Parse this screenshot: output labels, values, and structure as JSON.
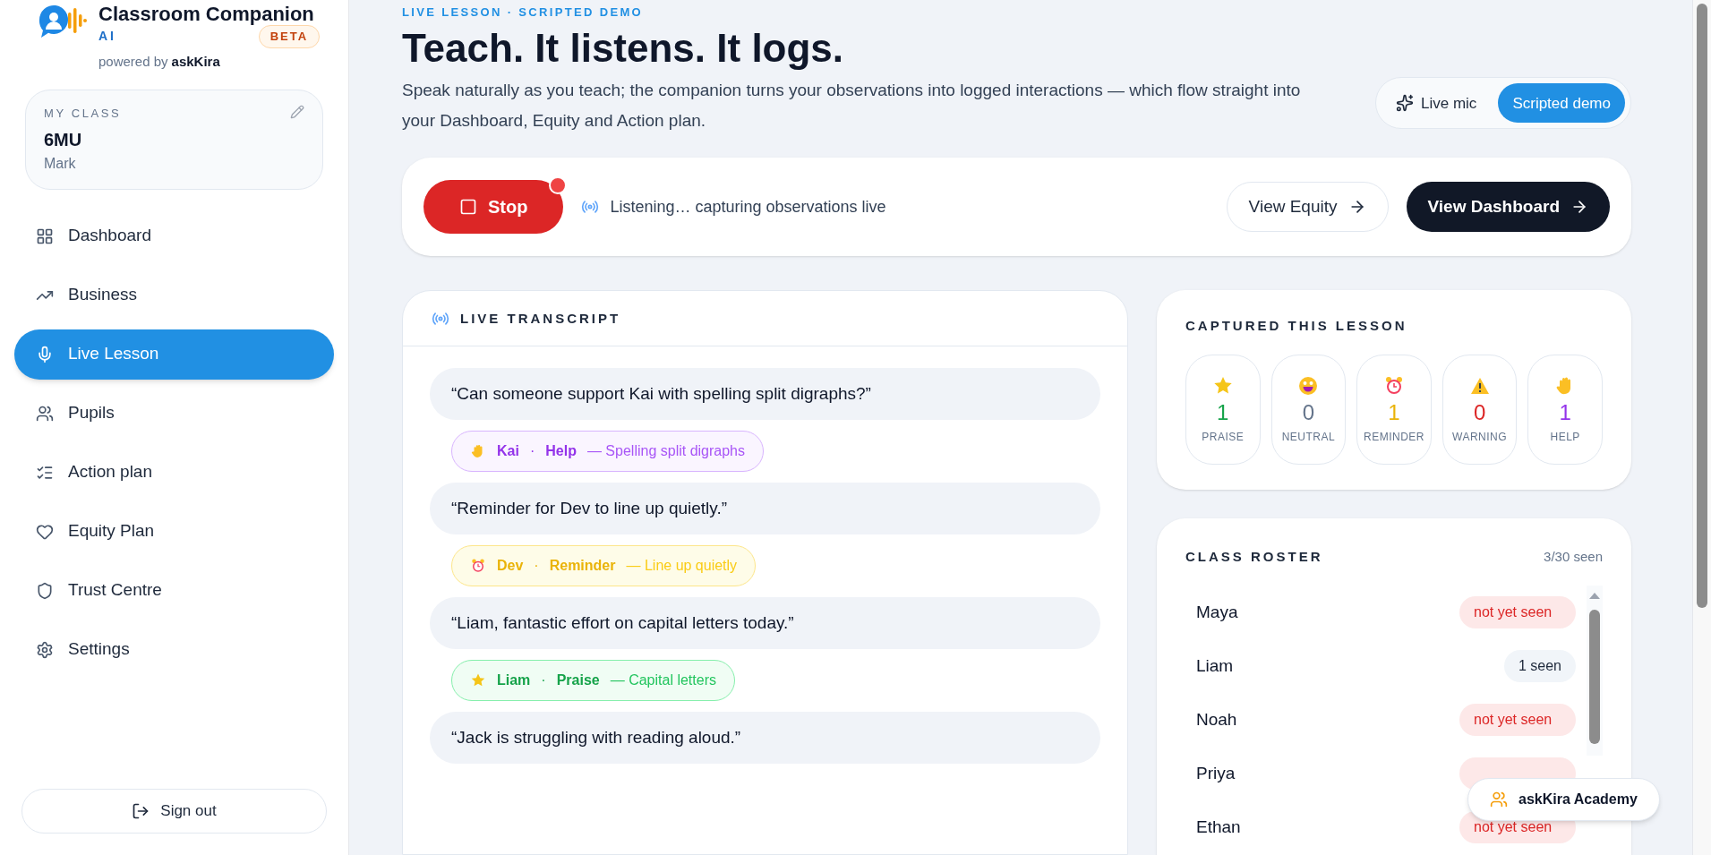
{
  "brand": {
    "title": "Classroom Companion",
    "subtitle": "AI",
    "badge": "BETA",
    "powered_prefix": "powered by",
    "powered_name": "askKira"
  },
  "class_card": {
    "label": "MY CLASS",
    "name": "6MU",
    "teacher": "Mark"
  },
  "nav": [
    {
      "label": "Dashboard",
      "selected": false
    },
    {
      "label": "Business",
      "selected": false
    },
    {
      "label": "Live Lesson",
      "selected": true
    },
    {
      "label": "Pupils",
      "selected": false
    },
    {
      "label": "Action plan",
      "selected": false
    },
    {
      "label": "Equity Plan",
      "selected": false
    },
    {
      "label": "Trust Centre",
      "selected": false
    },
    {
      "label": "Settings",
      "selected": false
    }
  ],
  "sign_out": "Sign out",
  "header": {
    "eyebrow": "LIVE LESSON · SCRIPTED DEMO",
    "title": "Teach. It listens. It logs.",
    "description": "Speak naturally as you teach; the companion turns your observations into logged interactions — which flow straight into your Dashboard, Equity and Action plan."
  },
  "mode_toggle": [
    {
      "label": "Live mic",
      "selected": false
    },
    {
      "label": "Scripted demo",
      "selected": true
    }
  ],
  "control_bar": {
    "stop_button": "Stop",
    "recording": true,
    "status": "Listening… capturing observations live",
    "view_equity": "View Equity",
    "view_dashboard": "View Dashboard"
  },
  "transcript": {
    "title": "LIVE TRANSCRIPT",
    "items": [
      {
        "quote": "“Can someone support Kai with spelling split digraphs?”",
        "tag": {
          "kind": "help",
          "pupil": "Kai",
          "separator": "·",
          "category": "Help",
          "note": "— Spelling split digraphs"
        }
      },
      {
        "quote": "“Reminder for Dev to line up quietly.”",
        "tag": {
          "kind": "reminder",
          "pupil": "Dev",
          "separator": "·",
          "category": "Reminder",
          "note": "— Line up quietly"
        }
      },
      {
        "quote": "“Liam, fantastic effort on capital letters today.”",
        "tag": {
          "kind": "praise",
          "pupil": "Liam",
          "separator": "·",
          "category": "Praise",
          "note": "— Capital letters"
        }
      },
      {
        "quote": "“Jack is struggling with reading aloud.”"
      }
    ]
  },
  "captured": {
    "title": "CAPTURED THIS LESSON",
    "counts": [
      {
        "kind": "praise",
        "count": "1",
        "label": "PRAISE"
      },
      {
        "kind": "neutral",
        "count": "0",
        "label": "NEUTRAL"
      },
      {
        "kind": "reminder",
        "count": "1",
        "label": "REMINDER"
      },
      {
        "kind": "warning",
        "count": "0",
        "label": "WARNING"
      },
      {
        "kind": "help",
        "count": "1",
        "label": "HELP"
      }
    ]
  },
  "roster": {
    "title": "CLASS ROSTER",
    "seen_count": "3/30 seen",
    "pupils": [
      {
        "name": "Maya",
        "status": {
          "kind": "unseen",
          "label": "not yet seen"
        }
      },
      {
        "name": "Liam",
        "status": {
          "kind": "seen",
          "label": "1 seen"
        }
      },
      {
        "name": "Noah",
        "status": {
          "kind": "unseen",
          "label": "not yet seen"
        }
      },
      {
        "name": "Priya",
        "status": {
          "kind": "unseen"
        }
      },
      {
        "name": "Ethan",
        "status": {
          "kind": "unseen",
          "label": "not yet seen"
        }
      }
    ]
  },
  "academy_button": "askKira Academy"
}
